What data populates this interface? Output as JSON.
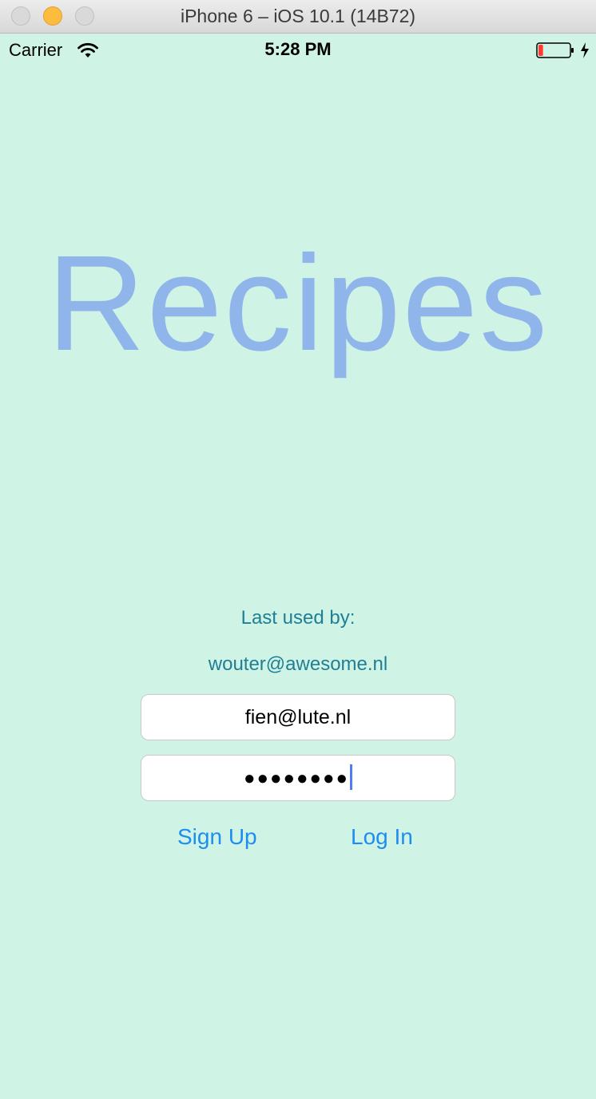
{
  "window": {
    "title": "iPhone 6 – iOS 10.1 (14B72)"
  },
  "status_bar": {
    "carrier": "Carrier",
    "time": "5:28 PM",
    "battery_level": 0.15,
    "charging": true
  },
  "app": {
    "title": "Recipes"
  },
  "login": {
    "last_used_label": "Last used by:",
    "last_used_email": "wouter@awesome.nl",
    "email_value": "fien@lute.nl",
    "password_masked": "●●●●●●●●",
    "signup_label": "Sign Up",
    "login_label": "Log In"
  },
  "colors": {
    "background": "#cff3e5",
    "title": "#8fb5ea",
    "label": "#217f95",
    "link": "#1e8df0",
    "caret": "#4d7cf4",
    "battery_low": "#ff3b30"
  }
}
